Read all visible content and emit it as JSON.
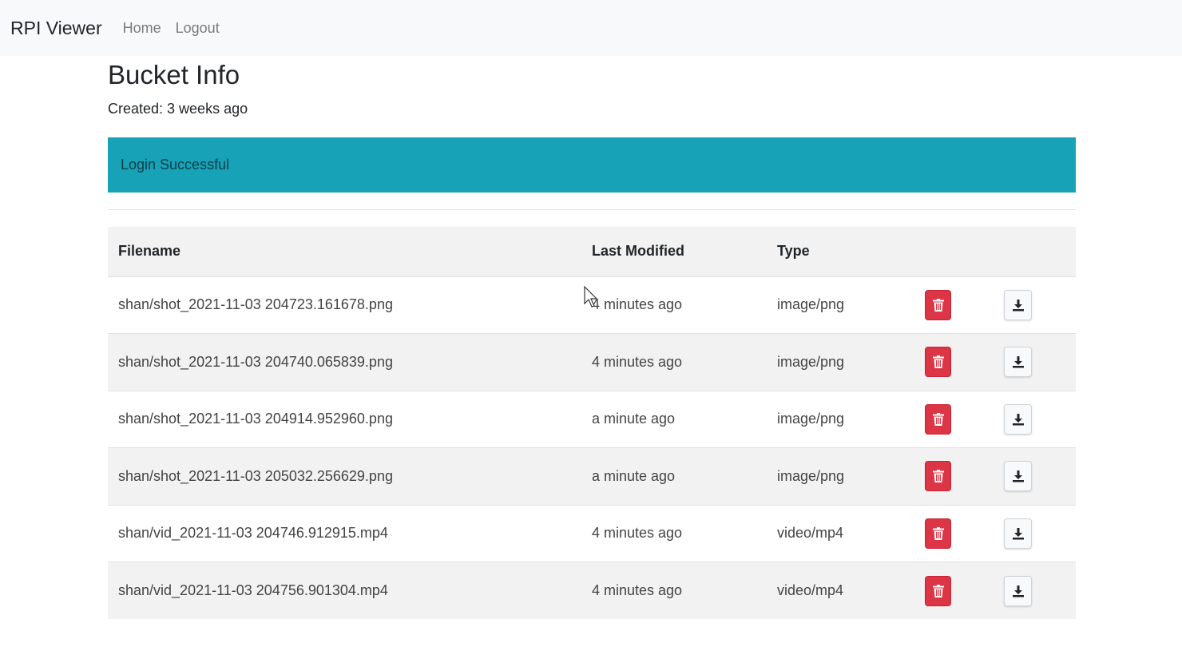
{
  "navbar": {
    "brand": "RPI Viewer",
    "links": [
      "Home",
      "Logout"
    ]
  },
  "page": {
    "title": "Bucket Info",
    "created": "Created: 3 weeks ago"
  },
  "alert": {
    "message": "Login Successful",
    "color": "#17a2b8"
  },
  "table": {
    "headers": [
      "Filename",
      "Last Modified",
      "Type"
    ],
    "rows": [
      {
        "filename": "shan/shot_2021-11-03 204723.161678.png",
        "modified": "4 minutes ago",
        "type": "image/png"
      },
      {
        "filename": "shan/shot_2021-11-03 204740.065839.png",
        "modified": "4 minutes ago",
        "type": "image/png"
      },
      {
        "filename": "shan/shot_2021-11-03 204914.952960.png",
        "modified": "a minute ago",
        "type": "image/png"
      },
      {
        "filename": "shan/shot_2021-11-03 205032.256629.png",
        "modified": "a minute ago",
        "type": "image/png"
      },
      {
        "filename": "shan/vid_2021-11-03 204746.912915.mp4",
        "modified": "4 minutes ago",
        "type": "video/mp4"
      },
      {
        "filename": "shan/vid_2021-11-03 204756.901304.mp4",
        "modified": "4 minutes ago",
        "type": "video/mp4"
      }
    ],
    "delete_icon": "trash-icon",
    "download_icon": "download-icon",
    "delete_color": "#dc3545"
  }
}
